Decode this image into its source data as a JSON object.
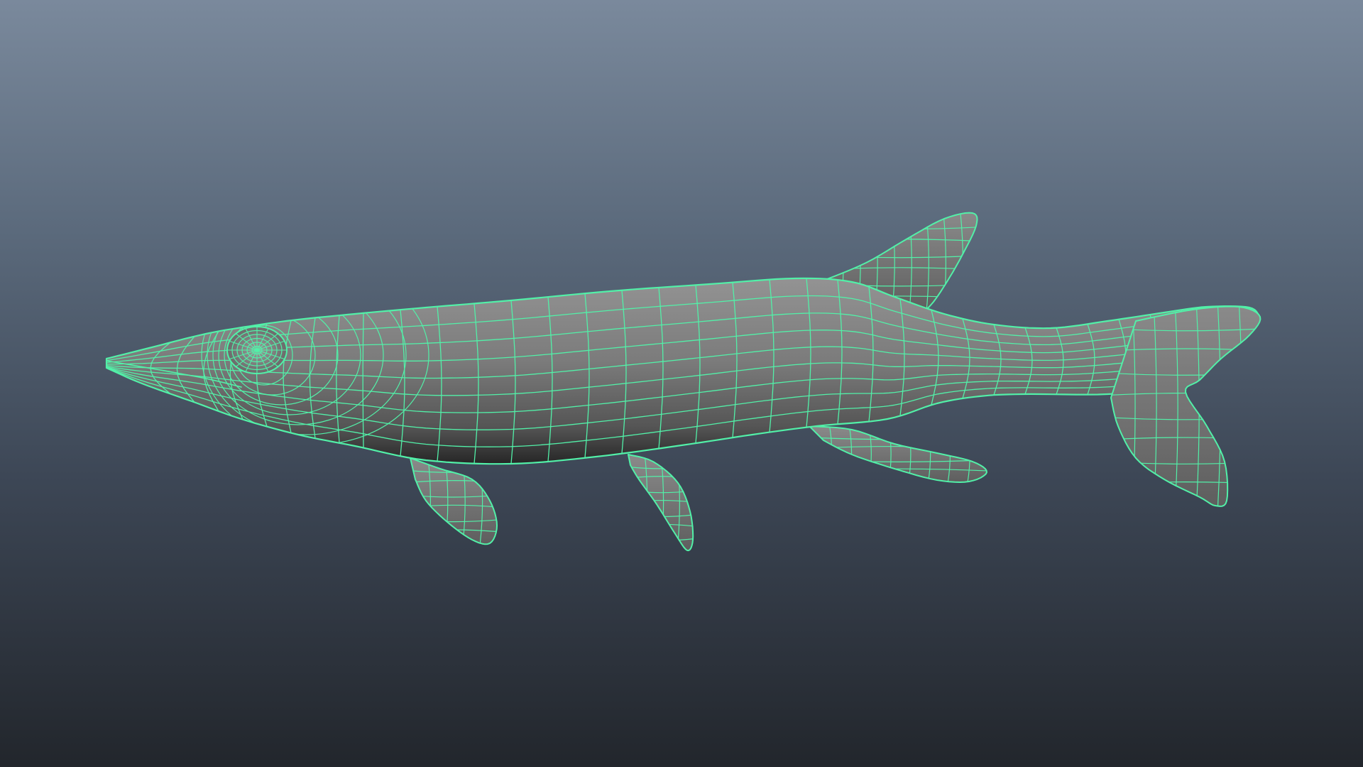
{
  "viewport": {
    "camera": "perspective",
    "background_gradient": [
      "#7a899c",
      "#5b6a7c",
      "#3d4756",
      "#22262c"
    ],
    "selected_object": "fish-mesh",
    "display_mode": "smooth-shaded-with-wireframe"
  },
  "colors": {
    "wireframe": "#52f0a8",
    "surface_light": "#8a8a8a",
    "surface_mid": "#6e6e6e",
    "surface_dark": "#2f2f2f"
  }
}
